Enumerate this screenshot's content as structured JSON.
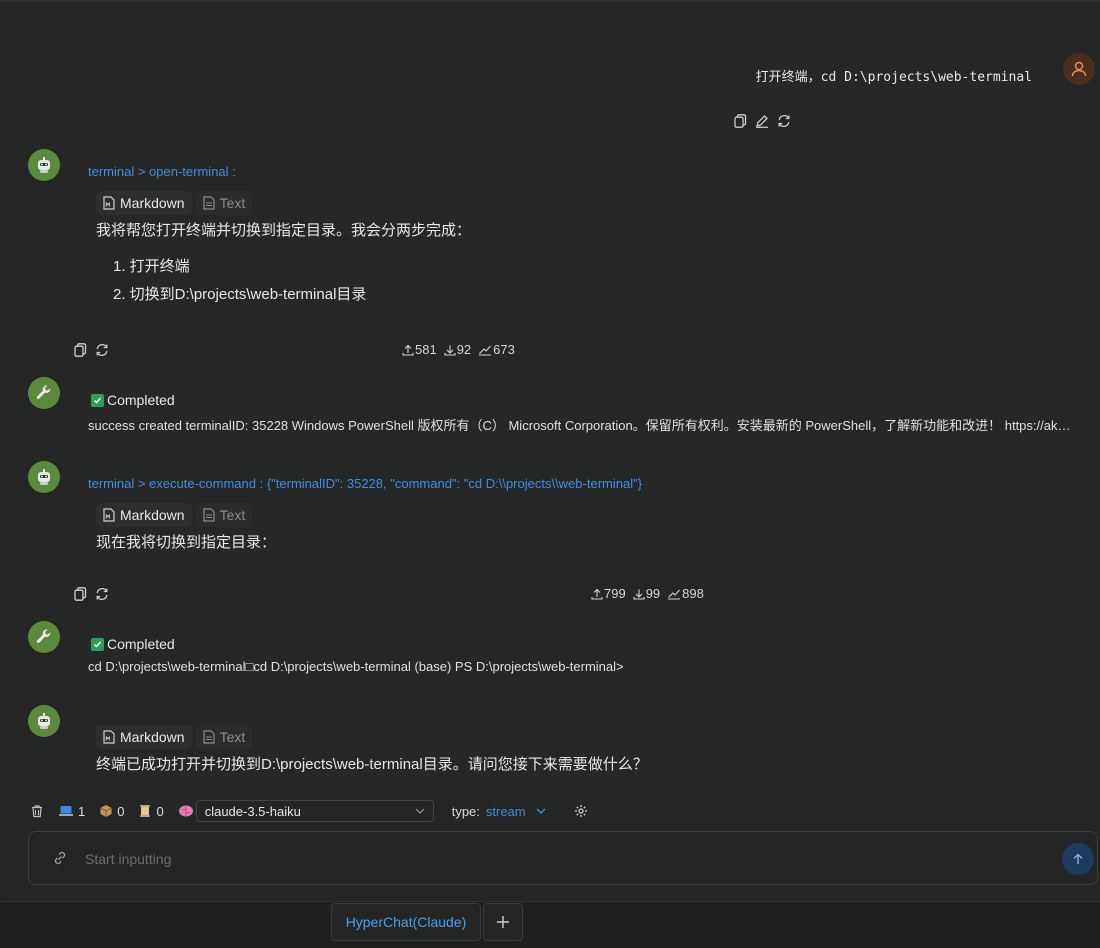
{
  "user_message": {
    "text": "打开终端，cd D:\\projects\\web-terminal"
  },
  "messages": [
    {
      "tool_title": "terminal > open-terminal :",
      "tab_markdown": "Markdown",
      "tab_text": "Text",
      "content": "我将帮您打开终端并切换到指定目录。我会分两步完成：",
      "list": [
        "1. 打开终端",
        "2. 切换到D:\\projects\\web-terminal目录"
      ],
      "stats": {
        "up": "581",
        "down": "92",
        "total": "673"
      }
    },
    {
      "status": "Completed",
      "result": "success created terminalID: 35228 Windows PowerShell 版权所有（C） Microsoft Corporation。保留所有权利。安装最新的 PowerShell，了解新功能和改进！ https://aka.ms/PSWindows"
    },
    {
      "tool_title": "terminal > execute-command : {\"terminalID\": 35228, \"command\": \"cd D:\\\\projects\\\\web-terminal\"}",
      "tab_markdown": "Markdown",
      "tab_text": "Text",
      "content": "现在我将切换到指定目录：",
      "stats": {
        "up": "799",
        "down": "99",
        "total": "898"
      }
    },
    {
      "status": "Completed",
      "result": "cd D:\\projects\\web-terminal□cd D:\\projects\\web-terminal (base) PS D:\\projects\\web-terminal>"
    },
    {
      "tab_markdown": "Markdown",
      "tab_text": "Text",
      "content": "终端已成功打开并切换到D:\\projects\\web-terminal目录。请问您接下来需要做什么？"
    }
  ],
  "toolbar": {
    "terminal_count": "1",
    "package_count": "0",
    "scroll_count": "0",
    "model": "claude-3.5-haiku",
    "type_label": "type:",
    "type_value": "stream"
  },
  "input": {
    "placeholder": "Start inputting"
  },
  "tabs": {
    "active": "HyperChat(Claude)",
    "add": "+"
  },
  "colors": {
    "accent": "#3d8ee0",
    "bot_avatar": "#5c8a3d",
    "completed": "#29a05a"
  }
}
